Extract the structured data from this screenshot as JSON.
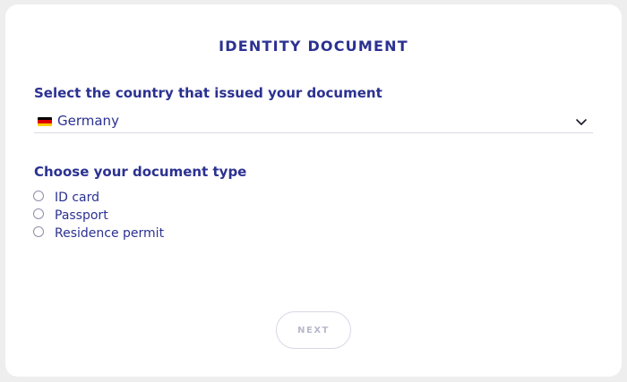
{
  "header": {
    "title": "IDENTITY DOCUMENT"
  },
  "country": {
    "label": "Select the country that issued your document",
    "selected": "Germany",
    "flag_icon": "germany-flag-icon",
    "flag_colors": [
      "#000000",
      "#dd0000",
      "#ffce00"
    ]
  },
  "document_type": {
    "label": "Choose your document type",
    "options": [
      {
        "label": "ID card",
        "selected": false
      },
      {
        "label": "Passport",
        "selected": false
      },
      {
        "label": "Residence permit",
        "selected": false
      }
    ]
  },
  "actions": {
    "next_label": "NEXT",
    "next_enabled": false
  },
  "colors": {
    "accent": "#2b3191",
    "disabled": "#b8b8cc",
    "border": "#d8d8e2",
    "background": "#eeeeee",
    "card": "#ffffff"
  }
}
